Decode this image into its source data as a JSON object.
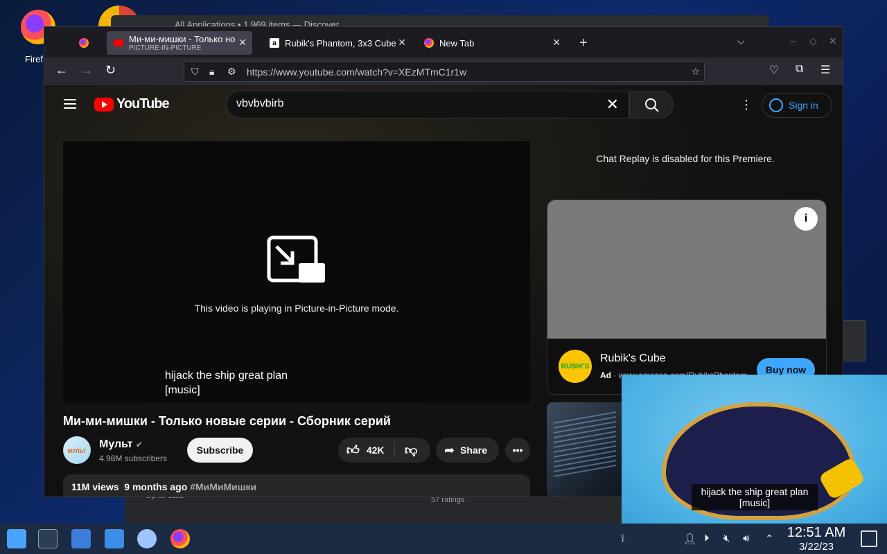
{
  "desktop": {
    "icon_label": "Firef",
    "bg_window_title": "All Applications • 1,969 items — Discover",
    "bg_text_left": "Up to date",
    "bg_text_right": "57 ratings"
  },
  "browser": {
    "tabs": [
      {
        "title": "",
        "icon": "firefox-icon"
      },
      {
        "title": "Ми-ми-мишки - Только но",
        "subtitle": "PICTURE-IN-PICTURE",
        "icon": "youtube-icon"
      },
      {
        "title": "Rubik's Phantom, 3x3 Cube",
        "icon": "amazon-icon"
      },
      {
        "title": "New Tab",
        "icon": "firefox-icon"
      }
    ],
    "url": "https://www.youtube.com/watch?v=XEzMTmC1r1w"
  },
  "youtube": {
    "logo_text": "YouTube",
    "search_value": "vbvbvbirb",
    "sign_in": "Sign in",
    "player": {
      "pip_message": "This video is playing in Picture-in-Picture mode.",
      "caption_line1": "hijack the ship great plan",
      "caption_line2": "[music]"
    },
    "video_title": "Ми-ми-мишки - Только новые серии - Сборник серий",
    "channel": {
      "name": "Мульт",
      "subscribers": "4.98M subscribers",
      "avatar_text": "МУЛЬТ"
    },
    "subscribe": "Subscribe",
    "likes": "42K",
    "share": "Share",
    "description": {
      "views": "11M views",
      "age": "9 months ago",
      "hashtag": "#МиМиМишки"
    },
    "chat_message": "Chat Replay is disabled for this Premiere.",
    "ad": {
      "title": "Rubik's Cube",
      "label": "Ad",
      "url": "www.amazon.com/RubiksPhantom",
      "cta": "Buy now",
      "logo_text": "RUBIK'S"
    }
  },
  "pip_window": {
    "caption_line1": "hijack the ship great plan",
    "caption_line2": "[music]"
  },
  "taskbar": {
    "time": "12:51 AM",
    "date": "3/22/23"
  },
  "colors": {
    "accent": "#3ea6ff",
    "youtube_red": "#ff0000",
    "taskbar": "#1b2b44"
  }
}
